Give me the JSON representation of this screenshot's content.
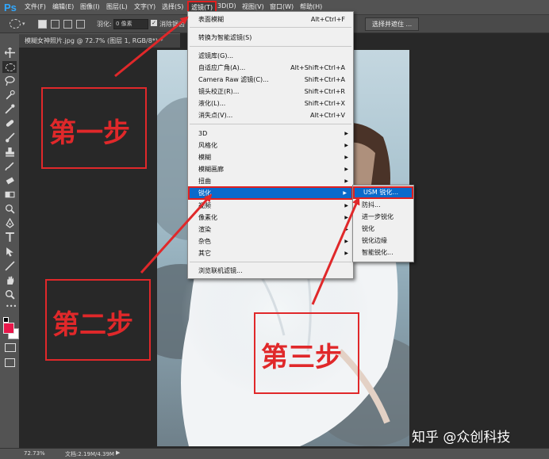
{
  "app": {
    "logo": "Ps"
  },
  "menubar": {
    "items": [
      "文件(F)",
      "编辑(E)",
      "图像(I)",
      "图层(L)",
      "文字(Y)",
      "选择(S)",
      "滤镜(T)",
      "3D(D)",
      "视图(V)",
      "窗口(W)",
      "帮助(H)"
    ],
    "active": "滤镜(T)"
  },
  "options_bar": {
    "feather_label": "羽化:",
    "feather_value": "0 像素",
    "antialias_label": "消除锯齿",
    "select_mask_button": "选择并遮住 ..."
  },
  "document_tab": {
    "title": "模糊女神照片.jpg @ 72.7% (图层 1, RGB/8*) *"
  },
  "status_bar": {
    "zoom": "72.73%",
    "doc_size": "文档:2.19M/4.39M"
  },
  "filter_menu": {
    "items": [
      {
        "label": "表面模糊",
        "shortcut": "Alt+Ctrl+F"
      },
      {
        "label": "转换为智能滤镜(S)",
        "shortcut": ""
      },
      {
        "label": "滤镜库(G)...",
        "shortcut": ""
      },
      {
        "label": "自适应广角(A)...",
        "shortcut": "Alt+Shift+Ctrl+A"
      },
      {
        "label": "Camera Raw 滤镜(C)...",
        "shortcut": "Shift+Ctrl+A"
      },
      {
        "label": "镜头校正(R)...",
        "shortcut": "Shift+Ctrl+R"
      },
      {
        "label": "液化(L)...",
        "shortcut": "Shift+Ctrl+X"
      },
      {
        "label": "消失点(V)...",
        "shortcut": "Alt+Ctrl+V"
      },
      {
        "label": "3D",
        "shortcut": ""
      },
      {
        "label": "风格化",
        "shortcut": ""
      },
      {
        "label": "模糊",
        "shortcut": ""
      },
      {
        "label": "模糊画廊",
        "shortcut": ""
      },
      {
        "label": "扭曲",
        "shortcut": ""
      },
      {
        "label": "锐化",
        "shortcut": ""
      },
      {
        "label": "视频",
        "shortcut": ""
      },
      {
        "label": "像素化",
        "shortcut": ""
      },
      {
        "label": "渲染",
        "shortcut": ""
      },
      {
        "label": "杂色",
        "shortcut": ""
      },
      {
        "label": "其它",
        "shortcut": ""
      },
      {
        "label": "浏览联机滤镜...",
        "shortcut": ""
      }
    ]
  },
  "sharpen_submenu": {
    "items": [
      "USM 锐化...",
      "防抖...",
      "进一步锐化",
      "锐化",
      "锐化边缘",
      "智能锐化..."
    ]
  },
  "annotations": {
    "step1": "第一步",
    "step2": "第二步",
    "step3": "第三步"
  },
  "watermark": "知乎 @众创科技",
  "colors": {
    "accent_red": "#e0282a",
    "highlight_blue": "#0a6acb",
    "foreground_swatch": "#e8174a"
  }
}
